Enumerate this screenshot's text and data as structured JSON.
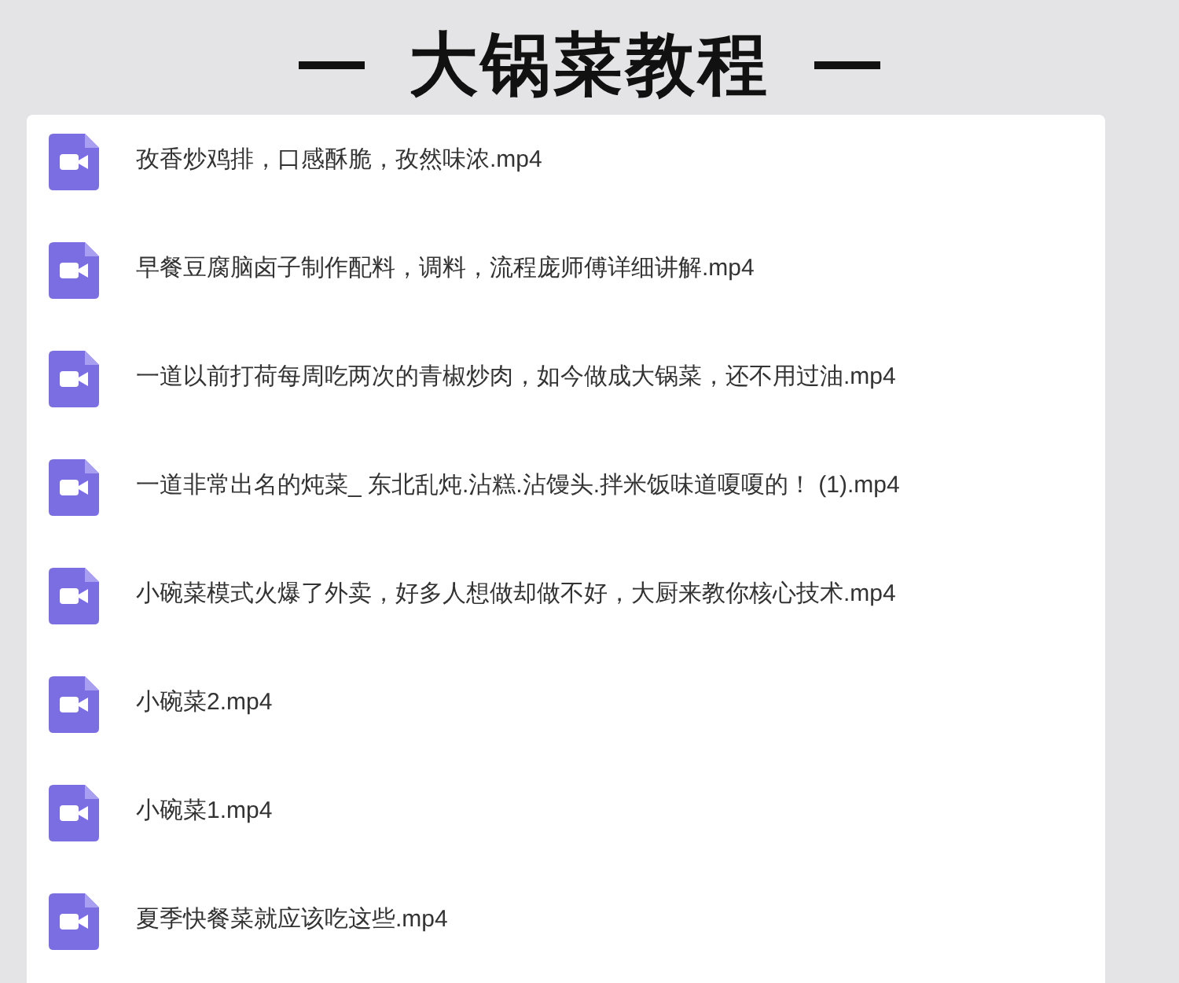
{
  "title": "大锅菜教程",
  "files": [
    {
      "name": "孜香炒鸡排，口感酥脆，孜然味浓.mp4"
    },
    {
      "name": "早餐豆腐脑卤子制作配料，调料，流程庞师傅详细讲解.mp4"
    },
    {
      "name": "一道以前打荷每周吃两次的青椒炒肉，如今做成大锅菜，还不用过油.mp4"
    },
    {
      "name": "一道非常出名的炖菜_ 东北乱炖.沾糕.沾馒头.拌米饭味道嗄嗄的！ (1).mp4"
    },
    {
      "name": "小碗菜模式火爆了外卖，好多人想做却做不好，大厨来教你核心技术.mp4"
    },
    {
      "name": "小碗菜2.mp4"
    },
    {
      "name": "小碗菜1.mp4"
    },
    {
      "name": "夏季快餐菜就应该吃这些.mp4"
    }
  ]
}
